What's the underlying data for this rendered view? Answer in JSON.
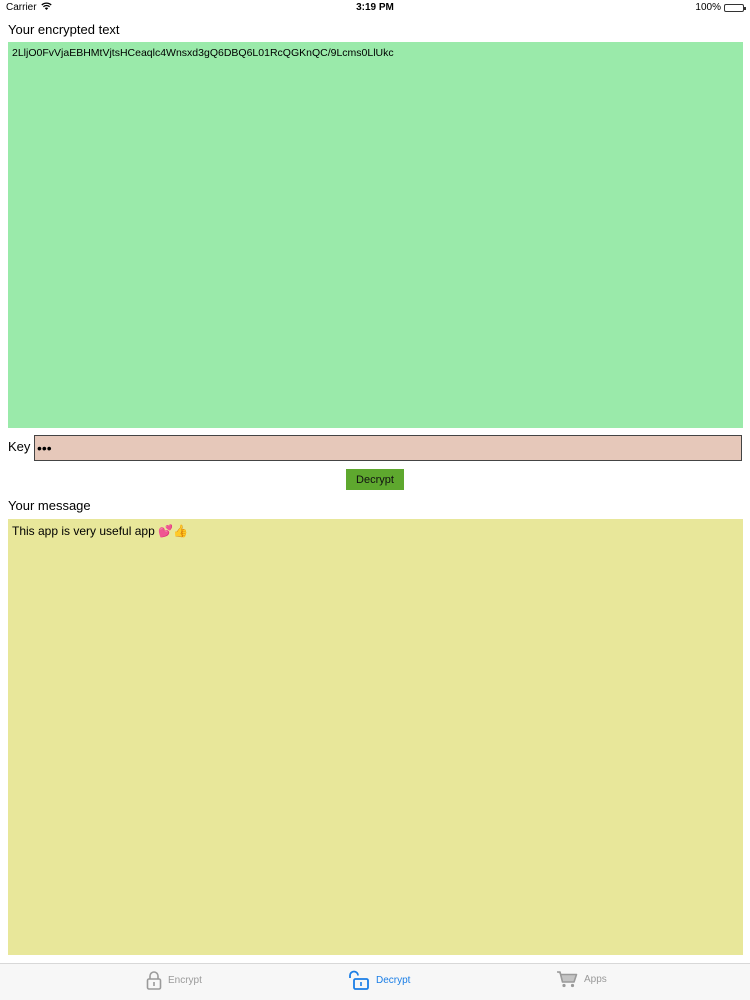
{
  "status_bar": {
    "carrier": "Carrier",
    "time": "3:19 PM",
    "battery": "100%"
  },
  "encrypted": {
    "label": "Your encrypted text",
    "value": "2LljO0FvVjaEBHMtVjtsHCeaqlc4Wnsxd3gQ6DBQ6L01RcQGKnQC/9Lcms0LlUkc",
    "background": "#9aeaaa"
  },
  "key": {
    "label": "Key",
    "value": "•••",
    "background": "#e6c8ba"
  },
  "decrypt_button": {
    "label": "Decrypt",
    "background": "#5ea82e"
  },
  "message": {
    "label": "Your message",
    "value": "This app is very useful app 💕👍",
    "background": "#e8e79a"
  },
  "tab_bar": {
    "tabs": [
      {
        "label": "Encrypt",
        "icon": "lock-icon",
        "active": false
      },
      {
        "label": "Decrypt",
        "icon": "unlock-icon",
        "active": true
      },
      {
        "label": "Apps",
        "icon": "cart-icon",
        "active": false
      }
    ],
    "active_color": "#1a7ee6",
    "inactive_color": "#9a9a9a"
  }
}
